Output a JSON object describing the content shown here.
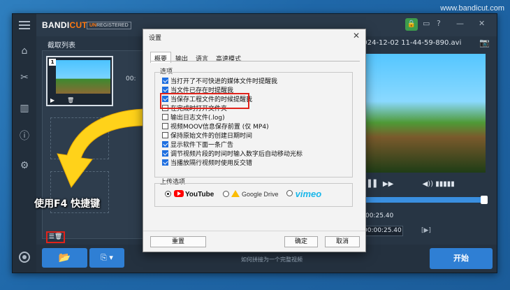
{
  "site": "www.bandicut.com",
  "app": {
    "brand_a": "BANDI",
    "brand_b": "CUT",
    "unregistered_a": "UN",
    "unregistered_b": "REGISTERED",
    "panel_title": "截取列表",
    "video_title": "2024-12-02 11-44-59-890.avi",
    "thumb_number": "1",
    "thumb_time": "00:",
    "time_left": "00:25.40",
    "time_field": "00:00:25.40",
    "play_segment": "[▶]",
    "tip": "如何拼接为一个完整视频",
    "start_button": "开始"
  },
  "callout": "使用F4 快捷键",
  "dialog": {
    "title": "设置",
    "tabs": [
      "概要",
      "输出",
      "语言",
      "高速模式"
    ],
    "options_header": "选项",
    "options": [
      {
        "label": "当打开了不可快进的媒体文件时提醒我",
        "checked": true
      },
      {
        "label": "当文件已存在时提醒我",
        "checked": true
      },
      {
        "label": "当保存工程文件的时候提醒我",
        "checked": true
      },
      {
        "label": "在完成时打开文件夹",
        "checked": false
      },
      {
        "label": "输出日志文件(.log)",
        "checked": false
      },
      {
        "label": "视频MOOV信息保存前置 (仅 MP4)",
        "checked": false
      },
      {
        "label": "保持原始文件的创建日期时间",
        "checked": false
      },
      {
        "label": "显示软件下面一条广告",
        "checked": true
      },
      {
        "label": "调节视频片段的时间时输入数字后自动移动光标",
        "checked": true
      },
      {
        "label": "当播放隔行视频时使用反交错",
        "checked": true
      }
    ],
    "upload_header": "上传选项",
    "upload": {
      "youtube": "YouTube",
      "gdrive": "Google Drive",
      "vimeo": "vimeo"
    },
    "reset_button": "重置",
    "ok_button": "确定",
    "cancel_button": "取消"
  },
  "colors": {
    "accent": "#2f7fd4",
    "highlight": "#e0231b",
    "brand_orange": "#ff7a12",
    "arrow": "#ffd21a"
  }
}
